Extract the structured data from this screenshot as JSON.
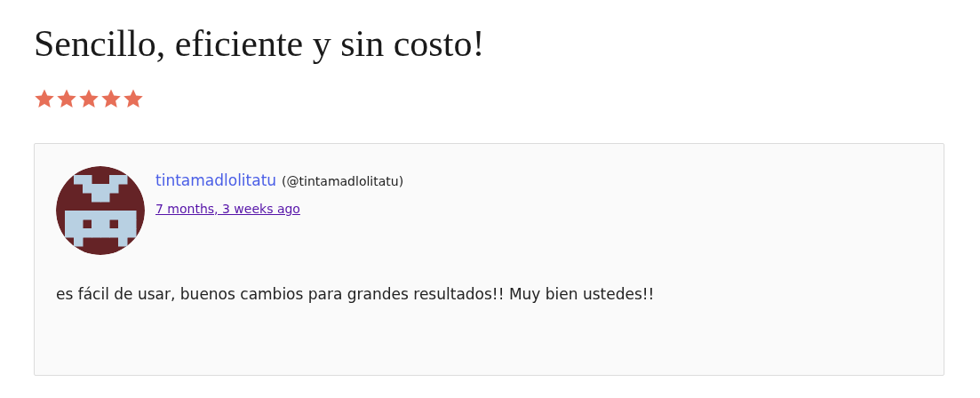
{
  "title": "Sencillo, eficiente y sin costo!",
  "rating": {
    "stars": 5
  },
  "review": {
    "author": "tintamadlolitatu",
    "handle": "(@tintamadlolitatu)",
    "time": "7 months, 3 weeks ago",
    "text": "es fácil de usar, buenos cambios para grandes resultados!! Muy bien ustedes!!"
  }
}
